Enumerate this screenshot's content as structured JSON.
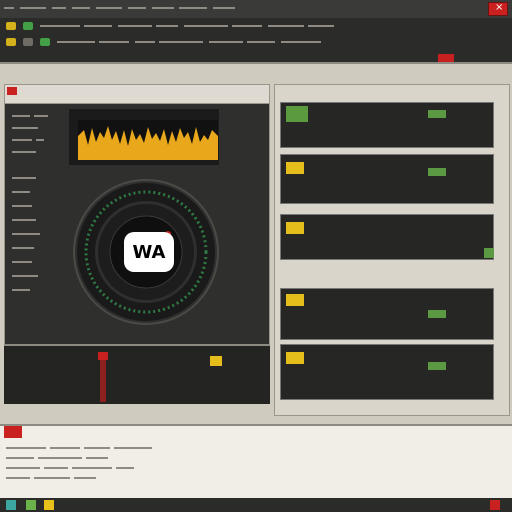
{
  "window": {
    "title": "",
    "close_symbol": "×"
  },
  "toolbar": {
    "menu_items": [
      "",
      "",
      "",
      "",
      "",
      "",
      "",
      "",
      ""
    ],
    "right_items": [
      "",
      "",
      "",
      ""
    ]
  },
  "left_panel": {
    "title": "",
    "labels": [
      "",
      "",
      "",
      "",
      "",
      "",
      "",
      "",
      "",
      "",
      "",
      ""
    ],
    "center_logo_text": "WA"
  },
  "right_panel": {
    "cards": [
      {
        "title": "",
        "meta": ""
      },
      {
        "title": "",
        "meta": ""
      },
      {
        "title": "",
        "meta": ""
      },
      {
        "title": "",
        "meta": ""
      },
      {
        "title": "",
        "meta": ""
      }
    ]
  },
  "bottom_panel": {
    "title": "",
    "items": [
      "",
      "",
      "",
      "",
      "",
      "",
      "",
      "",
      "",
      "",
      "",
      ""
    ]
  },
  "statusbar": {
    "items": [
      "",
      "",
      "",
      "",
      "",
      "",
      ""
    ]
  },
  "colors": {
    "accent_yellow": "#e8c21b",
    "accent_green": "#4ba650",
    "accent_red": "#c8201f"
  }
}
